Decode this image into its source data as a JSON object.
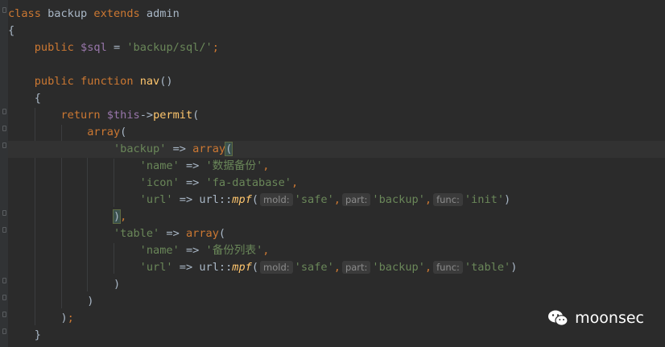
{
  "editor": {
    "lines": [
      {
        "tokens": [
          {
            "t": "class ",
            "c": "kw"
          },
          {
            "t": "backup ",
            "c": "id"
          },
          {
            "t": "extends ",
            "c": "kw"
          },
          {
            "t": "admin",
            "c": "id"
          }
        ]
      },
      {
        "tokens": [
          {
            "t": "{",
            "c": "op"
          }
        ]
      },
      {
        "tokens": [
          {
            "t": "    public ",
            "c": "kw"
          },
          {
            "t": "$sql",
            "c": "var"
          },
          {
            "t": " = ",
            "c": "op"
          },
          {
            "t": "'backup/sql/'",
            "c": "str"
          },
          {
            "t": ";",
            "c": "kw"
          }
        ]
      },
      {
        "tokens": []
      },
      {
        "tokens": [
          {
            "t": "    public function ",
            "c": "kw"
          },
          {
            "t": "nav",
            "c": "fn"
          },
          {
            "t": "()",
            "c": "op"
          }
        ]
      },
      {
        "tokens": [
          {
            "t": "    {",
            "c": "op"
          }
        ]
      },
      {
        "tokens": [
          {
            "t": "        return ",
            "c": "kw"
          },
          {
            "t": "$this",
            "c": "var"
          },
          {
            "t": "->",
            "c": "op"
          },
          {
            "t": "permit",
            "c": "fn"
          },
          {
            "t": "(",
            "c": "op"
          }
        ]
      },
      {
        "tokens": [
          {
            "t": "            array",
            "c": "kw"
          },
          {
            "t": "(",
            "c": "op"
          }
        ]
      },
      {
        "tokens": [
          {
            "t": "                'backup'",
            "c": "str"
          },
          {
            "t": " => ",
            "c": "op"
          },
          {
            "t": "array",
            "c": "kw"
          },
          {
            "t": "(",
            "c": "paren"
          }
        ]
      },
      {
        "tokens": [
          {
            "t": "                    'name'",
            "c": "str"
          },
          {
            "t": " => ",
            "c": "op"
          },
          {
            "t": "'数据备份'",
            "c": "str"
          },
          {
            "t": ",",
            "c": "kw"
          }
        ]
      },
      {
        "tokens": [
          {
            "t": "                    'icon'",
            "c": "str"
          },
          {
            "t": " => ",
            "c": "op"
          },
          {
            "t": "'fa-database'",
            "c": "str"
          },
          {
            "t": ",",
            "c": "kw"
          }
        ]
      },
      {
        "tokens": [
          {
            "t": "                    'url'",
            "c": "str"
          },
          {
            "t": " => ",
            "c": "op"
          },
          {
            "t": "url",
            "c": "id"
          },
          {
            "t": "::",
            "c": "op"
          },
          {
            "t": "mpf",
            "c": "it"
          },
          {
            "t": "(",
            "c": "op"
          },
          {
            "t": "mold:",
            "c": "hint"
          },
          {
            "t": "'safe'",
            "c": "str"
          },
          {
            "t": ",",
            "c": "kw"
          },
          {
            "t": "part:",
            "c": "hint"
          },
          {
            "t": "'backup'",
            "c": "str"
          },
          {
            "t": ",",
            "c": "kw"
          },
          {
            "t": "func:",
            "c": "hint"
          },
          {
            "t": "'init'",
            "c": "str"
          },
          {
            "t": ")",
            "c": "op"
          }
        ]
      },
      {
        "tokens": [
          {
            "t": "                ),",
            "c": "closehl"
          }
        ]
      },
      {
        "tokens": [
          {
            "t": "                'table'",
            "c": "str"
          },
          {
            "t": " => ",
            "c": "op"
          },
          {
            "t": "array",
            "c": "kw"
          },
          {
            "t": "(",
            "c": "op"
          }
        ]
      },
      {
        "tokens": [
          {
            "t": "                    'name'",
            "c": "str"
          },
          {
            "t": " => ",
            "c": "op"
          },
          {
            "t": "'备份列表'",
            "c": "str"
          },
          {
            "t": ",",
            "c": "kw"
          }
        ]
      },
      {
        "tokens": [
          {
            "t": "                    'url'",
            "c": "str"
          },
          {
            "t": " => ",
            "c": "op"
          },
          {
            "t": "url",
            "c": "id"
          },
          {
            "t": "::",
            "c": "op"
          },
          {
            "t": "mpf",
            "c": "it"
          },
          {
            "t": "(",
            "c": "op"
          },
          {
            "t": "mold:",
            "c": "hint"
          },
          {
            "t": "'safe'",
            "c": "str"
          },
          {
            "t": ",",
            "c": "kw"
          },
          {
            "t": "part:",
            "c": "hint"
          },
          {
            "t": "'backup'",
            "c": "str"
          },
          {
            "t": ",",
            "c": "kw"
          },
          {
            "t": "func:",
            "c": "hint"
          },
          {
            "t": "'table'",
            "c": "str"
          },
          {
            "t": ")",
            "c": "op"
          }
        ]
      },
      {
        "tokens": [
          {
            "t": "                )",
            "c": "op"
          }
        ]
      },
      {
        "tokens": [
          {
            "t": "            )",
            "c": "op"
          }
        ]
      },
      {
        "tokens": [
          {
            "t": "        )",
            "c": "op"
          },
          {
            "t": ";",
            "c": "kw"
          }
        ]
      },
      {
        "tokens": [
          {
            "t": "    }",
            "c": "op"
          }
        ]
      }
    ],
    "current_line": 8
  },
  "watermark": {
    "text": "moonsec",
    "icon": "wechat-icon"
  }
}
